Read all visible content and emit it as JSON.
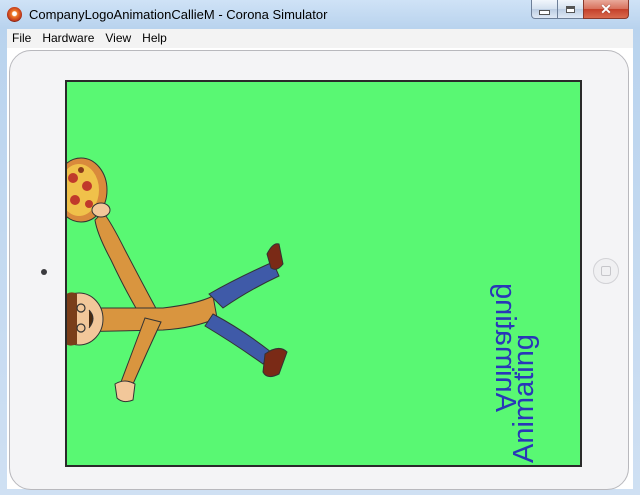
{
  "window": {
    "title": "CompanyLogoAnimationCallieM - Corona Simulator",
    "icon": "corona-icon",
    "controls": [
      "minimize-icon",
      "maximize-icon",
      "close-icon"
    ],
    "close_glyph": "✕"
  },
  "menu": [
    "File",
    "Hardware",
    "View",
    "Help"
  ],
  "device": {
    "type": "iPad",
    "orientation": "landscape",
    "screen_background": "#59F873"
  },
  "app_screen": {
    "texts": [
      "Animating",
      "Animating"
    ],
    "text_color": "#2936B8",
    "images": [
      "pizza-chef-figure"
    ]
  }
}
